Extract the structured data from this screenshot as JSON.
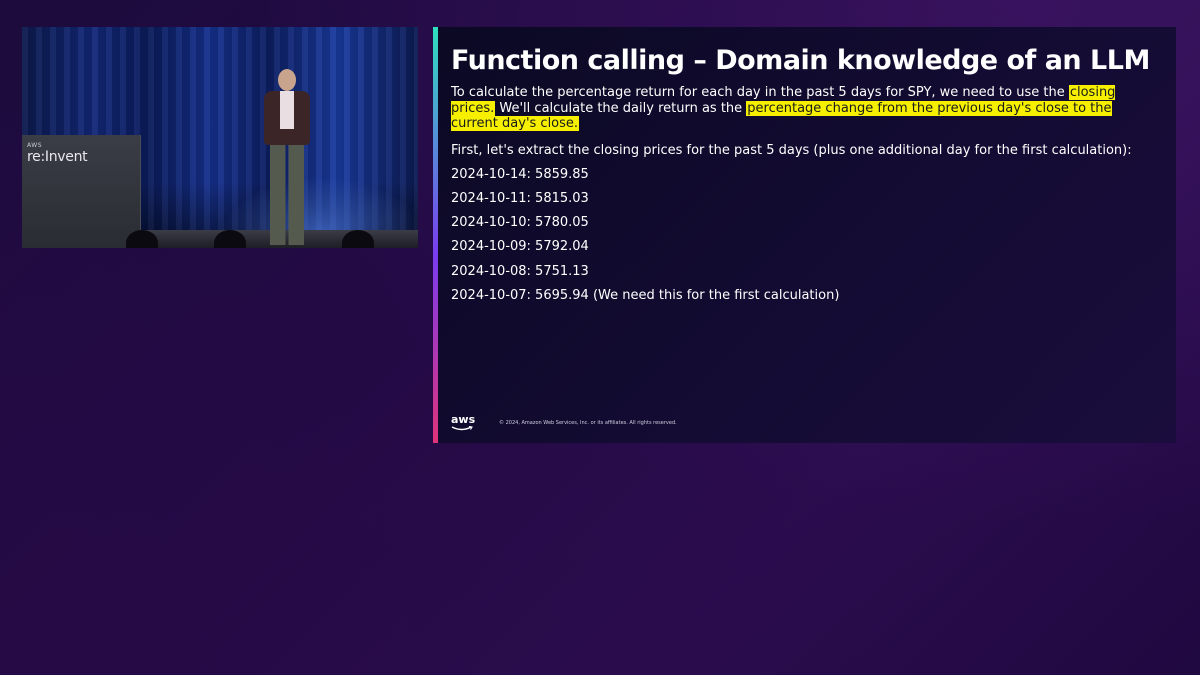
{
  "video": {
    "podium_logo_small": "AWS",
    "podium_logo_big": "re:Invent"
  },
  "slide": {
    "title": "Function calling – Domain knowledge of an LLM",
    "intro": {
      "part1": "To calculate the percentage return for each day in the past 5 days for SPY, we need to use the ",
      "highlight1": "closing prices.",
      "part2": " We'll calculate the daily return as the ",
      "highlight2": "percentage change from the previous day's close to the current day's close."
    },
    "lead": "First, let's extract the closing prices for the past 5 days (plus one additional day for the first calculation):",
    "prices": [
      "2024-10-14: 5859.85",
      "2024-10-11: 5815.03",
      "2024-10-10: 5780.05",
      "2024-10-09: 5792.04",
      "2024-10-08: 5751.13",
      "2024-10-07: 5695.94 (We need this for the first calculation)"
    ],
    "footer": {
      "logo_text": "aws",
      "copyright": "© 2024, Amazon Web Services, Inc. or its affiliates. All rights reserved."
    }
  },
  "colors": {
    "highlight": "#f6f000",
    "accent_top": "#2fe0c0",
    "accent_bottom": "#e0337a",
    "background": "#230a45"
  }
}
